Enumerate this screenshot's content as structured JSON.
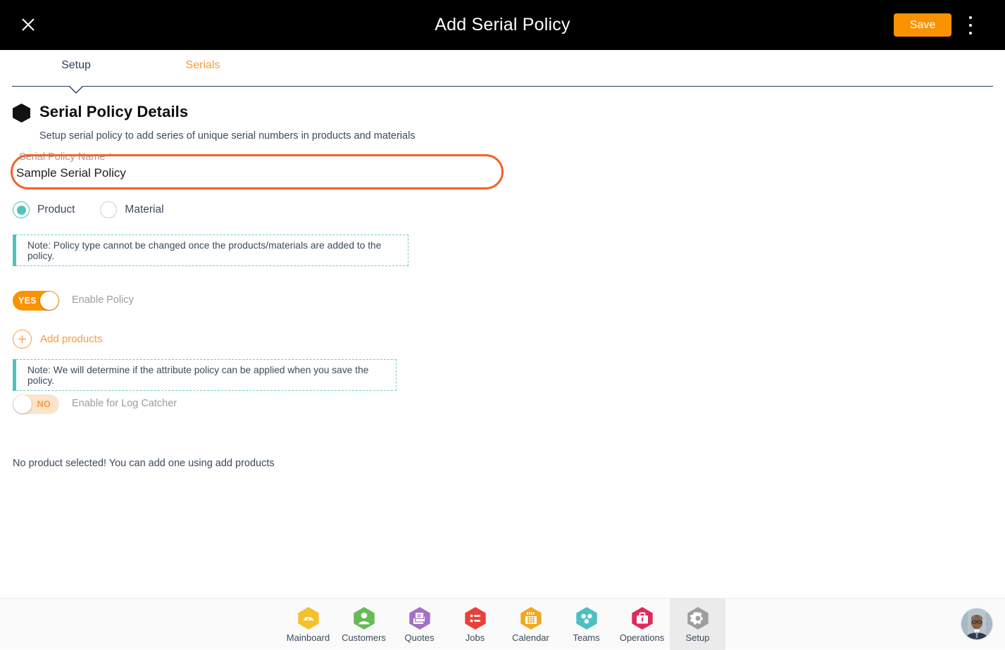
{
  "header": {
    "title": "Add Serial Policy",
    "close_icon": "close-icon",
    "save_label": "Save",
    "overflow_icon": "kebab-menu-icon"
  },
  "tabs": [
    {
      "label": "Setup",
      "active": true
    },
    {
      "label": "Serials",
      "active": false
    }
  ],
  "section": {
    "bullet_icon": "hexagon-bullet-icon",
    "title": "Serial Policy Details",
    "subtitle": "Setup serial policy to add series of unique serial numbers in products and materials"
  },
  "policy_name_field": {
    "label": "Serial Policy Name *",
    "value": "Sample Serial Policy",
    "placeholder": "Serial Policy Name"
  },
  "policy_type": {
    "options": [
      {
        "label": "Product",
        "selected": true
      },
      {
        "label": "Material",
        "selected": false
      }
    ]
  },
  "notes": {
    "policy_type_note": "Note: Policy type cannot be changed once the products/materials are added to the policy.",
    "attribute_note": "Note: We will determine if the attribute policy can be applied when you save the policy."
  },
  "toggles": {
    "enable_policy": {
      "state_label": "YES",
      "caption": "Enable Policy",
      "on": true
    },
    "log_catcher": {
      "state_label": "NO",
      "caption": "Enable for Log Catcher",
      "on": false
    }
  },
  "add_products": {
    "icon": "plus-circle-icon",
    "label": "Add products"
  },
  "empty_state": {
    "message": "No product selected! You can add one using add products"
  },
  "bottom_nav": {
    "items": [
      {
        "label": "Mainboard",
        "icon": "mainboard-icon",
        "color": "#f5c02e",
        "active": false
      },
      {
        "label": "Customers",
        "icon": "customers-icon",
        "color": "#66bb57",
        "active": false
      },
      {
        "label": "Quotes",
        "icon": "quotes-icon",
        "color": "#a46fc4",
        "active": false
      },
      {
        "label": "Jobs",
        "icon": "jobs-icon",
        "color": "#e8413b",
        "active": false
      },
      {
        "label": "Calendar",
        "icon": "calendar-icon",
        "color": "#f0a81e",
        "active": false
      },
      {
        "label": "Teams",
        "icon": "teams-icon",
        "color": "#4cc0c0",
        "active": false
      },
      {
        "label": "Operations",
        "icon": "operations-icon",
        "color": "#e0295a",
        "active": false
      },
      {
        "label": "Setup",
        "icon": "gear-icon",
        "color": "#9e9e9e",
        "active": true
      }
    ],
    "avatar": "user-avatar"
  },
  "colors": {
    "accent_orange": "#fb9200",
    "tab_orange": "#f79a3d",
    "highlight_orange": "#f4622b",
    "teal": "#4fc3bd",
    "navy": "#2a3f5f",
    "topbar_black": "#000000"
  }
}
